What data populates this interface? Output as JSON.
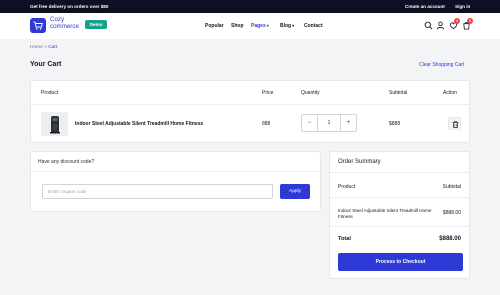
{
  "topbar": {
    "promo": "Get free delivery on orders over $80",
    "create_account": "Create an account",
    "sign_in": "Sign in"
  },
  "header": {
    "logo_line1": "Cozy",
    "logo_line2": "commerce",
    "badge": "Demo",
    "nav": [
      {
        "label": "Popular"
      },
      {
        "label": "Shop"
      },
      {
        "label": "Pages"
      },
      {
        "label": "Blog"
      },
      {
        "label": "Contact"
      }
    ],
    "wishlist_count": "1",
    "cart_count": "1",
    "accent_color": "#2f39d5"
  },
  "breadcrumb": {
    "home": "Home",
    "separator": ">",
    "current": "Cart"
  },
  "page": {
    "title": "Your Cart",
    "clear_label": "Clear Shopping Cart"
  },
  "cart": {
    "headers": {
      "product": "Product",
      "price": "Price",
      "quantity": "Quantity",
      "subtotal": "Subtotal",
      "action": "Action"
    },
    "items": [
      {
        "name": "Indoor Steel Adjustable Silent Treadmill Home Fitness",
        "price": "888",
        "quantity": "1",
        "subtotal": "$888"
      }
    ],
    "minus": "−",
    "plus": "+"
  },
  "discount": {
    "title": "Have any discount code?",
    "placeholder": "Enter coupon code",
    "apply_label": "Apply"
  },
  "summary": {
    "title": "Order Summary",
    "product_header": "Product",
    "subtotal_header": "Subtotal",
    "item_name": "Indoor Steel Adjustable Silent Treadmill Home Fitness",
    "item_price": "$888.00",
    "total_label": "Total",
    "total_value": "$888.00",
    "checkout_label": "Process to Checkout"
  }
}
